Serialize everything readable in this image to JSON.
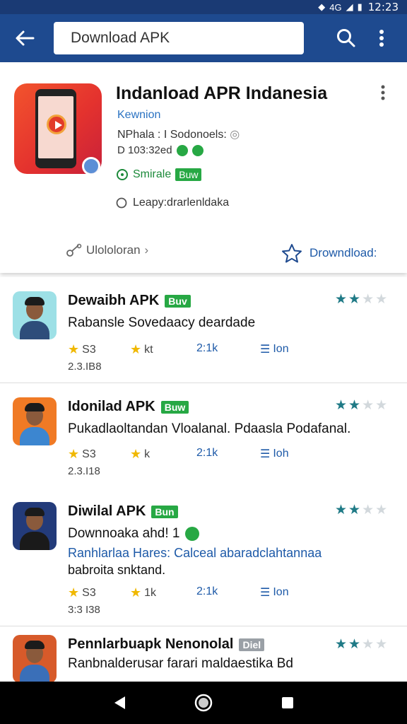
{
  "status_bar": {
    "time": "12:23",
    "signal": "4G"
  },
  "app_bar": {
    "search_value": "Download APK"
  },
  "featured": {
    "title": "Indanload APR Indanesia",
    "subtitle": "Kewnion",
    "line1": "NPhala : I Sodonoels: ",
    "line2": "D 103:32ed",
    "safe_label": "Smirale",
    "safe_badge": "Buw",
    "author": "Leapy:drarlenldaka",
    "more_link": "Ulololoran",
    "download_label": "Drowndload:"
  },
  "items": [
    {
      "title": "Dewaibh APK",
      "badge": "Buv",
      "badge_color": "#27a844",
      "desc_line1": "Rabansle Sovedaacy deardade",
      "desc_line2": "",
      "stat1": "S3",
      "stat2": "kt",
      "stat3": "2:1k",
      "stat4": "Ion",
      "size": "2.3.IB8",
      "rating": 2,
      "avatar_bg": "#9de0e6",
      "avatar_shirt": "#2e4d7a"
    },
    {
      "title": "Idonilad APK",
      "badge": "Buw",
      "badge_color": "#27a844",
      "desc_line1": "Pukadlaoltandan Vloalanal. Pdaasla Podafanal.",
      "desc_line2": "",
      "stat1": "S3",
      "stat2": "k",
      "stat3": "2:1k",
      "stat4": "Ioh",
      "size": "2.3.I18",
      "rating": 2,
      "avatar_bg": "#f07a25",
      "avatar_shirt": "#3c86d0"
    },
    {
      "title": "Diwilal APK",
      "badge": "Bun",
      "badge_color": "#27a844",
      "desc_line1": "Downnoaka ahd! 1",
      "desc_line2": "Ranhlarlaa Hares: Calceal abaradclahtannaa",
      "desc_line3": "babroita snktand.",
      "stat1": "S3",
      "stat2": "1k",
      "stat3": "2:1k",
      "stat4": "Ion",
      "size": "3:3 I38",
      "rating": 2,
      "avatar_bg": "#233b7a",
      "avatar_shirt": "#1a1a1a"
    },
    {
      "title": "Pennlarbuapk Nenonolal",
      "badge": "Diel",
      "badge_color": "#9aa0a6",
      "desc_line1": "Ranbnalderusar farari maldaestika Bd",
      "desc_line2": "",
      "rating": 2,
      "avatar_bg": "#d75a2a",
      "avatar_shirt": "#3a6fb8"
    }
  ],
  "colors": {
    "app_bar": "#1e4a8f",
    "accent_blue": "#1e5aa8",
    "accent_green": "#27a844",
    "star_yellow": "#f0b800",
    "star_teal": "#1f7a86"
  },
  "icons": [
    "back-arrow-icon",
    "search-icon",
    "more-vert-icon",
    "share-icon",
    "star-outline-icon",
    "list-icon",
    "back-triangle-icon",
    "home-circle-icon",
    "recents-square-icon"
  ]
}
